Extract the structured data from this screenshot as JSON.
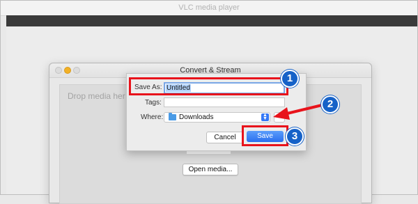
{
  "app": {
    "title": "VLC media player"
  },
  "convert_window": {
    "title": "Convert & Stream",
    "drop_label": "Drop media her",
    "open_media_label": "Open media..."
  },
  "save_sheet": {
    "save_as_label": "Save As:",
    "save_as_value": "Untitled",
    "tags_label": "Tags:",
    "tags_value": "",
    "where_label": "Where:",
    "where_value": "Downloads",
    "where_icon": "folder-icon",
    "cancel_label": "Cancel",
    "save_label": "Save"
  },
  "annotations": {
    "step1": "1",
    "step2": "2",
    "step3": "3",
    "highlight_color": "#e8131b",
    "badge_color": "#1662c8"
  },
  "colors": {
    "accent": "#3478f6",
    "selection": "#b3d4fc"
  }
}
